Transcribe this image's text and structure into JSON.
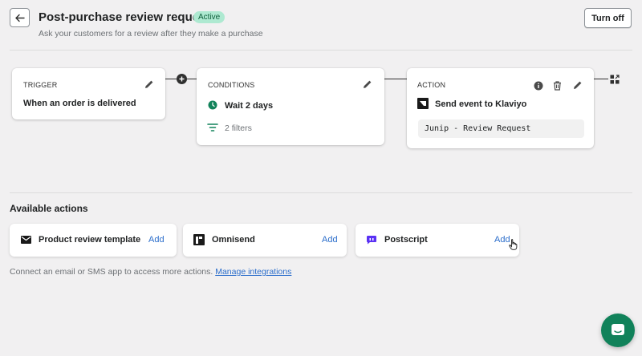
{
  "header": {
    "title": "Post-purchase review request",
    "status": "Active",
    "subtitle": "Ask your customers for a review after they make a purchase",
    "turn_off_label": "Turn off"
  },
  "workflow": {
    "trigger": {
      "label": "TRIGGER",
      "text": "When an order is delivered"
    },
    "conditions": {
      "label": "CONDITIONS",
      "wait": "Wait 2 days",
      "filters": "2 filters"
    },
    "action": {
      "label": "ACTION",
      "text": "Send event to Klaviyo",
      "code": "Junip - Review Request"
    }
  },
  "available_actions": {
    "title": "Available actions",
    "items": [
      {
        "name": "Product review template",
        "add_label": "Add",
        "icon": "mail-icon"
      },
      {
        "name": "Omnisend",
        "add_label": "Add",
        "icon": "omnisend-icon"
      },
      {
        "name": "Postscript",
        "add_label": "Add",
        "icon": "postscript-icon"
      }
    ],
    "footer_text": "Connect an email or SMS app to access more actions.",
    "footer_link": "Manage integrations"
  },
  "colors": {
    "accent": "#2c6ecb",
    "active_badge": "#aee9d1",
    "clock_green": "#11825a",
    "chat_green": "#11825a"
  }
}
